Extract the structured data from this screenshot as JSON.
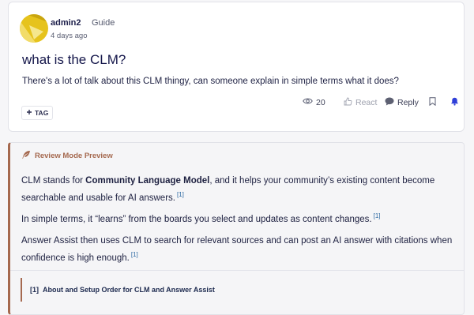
{
  "post": {
    "author": "admin2",
    "role": "Guide",
    "date": "4 days ago",
    "title": "what is the CLM?",
    "body": "There's a lot of talk about this CLM thingy, can someone explain in simple terms what it does?",
    "tag_label": "TAG",
    "views": "20",
    "react_label": "React",
    "reply_label": "Reply"
  },
  "review": {
    "header": "Review Mode Preview",
    "p1_pre": "CLM stands for ",
    "p1_bold": "Community Language Model",
    "p1_post": ", and it helps your community’s existing content become searchable and usable for AI answers.",
    "p2": "In simple terms, it “learns” from the boards you select and updates as content changes.",
    "p3": "Answer Assist then uses CLM to search for relevant sources and can post an AI answer with citations when confidence is high enough.",
    "cite_mark": "[1]",
    "reference_num": "[1]",
    "reference_title": "About and Setup Order for CLM and Answer Assist"
  },
  "colors": {
    "accent_brown": "#a5694f",
    "bell_blue": "#2f3fd8",
    "avatar_yellow": "#e6c31c"
  },
  "icons": [
    "eye-icon",
    "thumbs-up-icon",
    "chat-bubble-icon",
    "bookmark-icon",
    "bell-icon",
    "plus-icon",
    "feather-icon"
  ]
}
